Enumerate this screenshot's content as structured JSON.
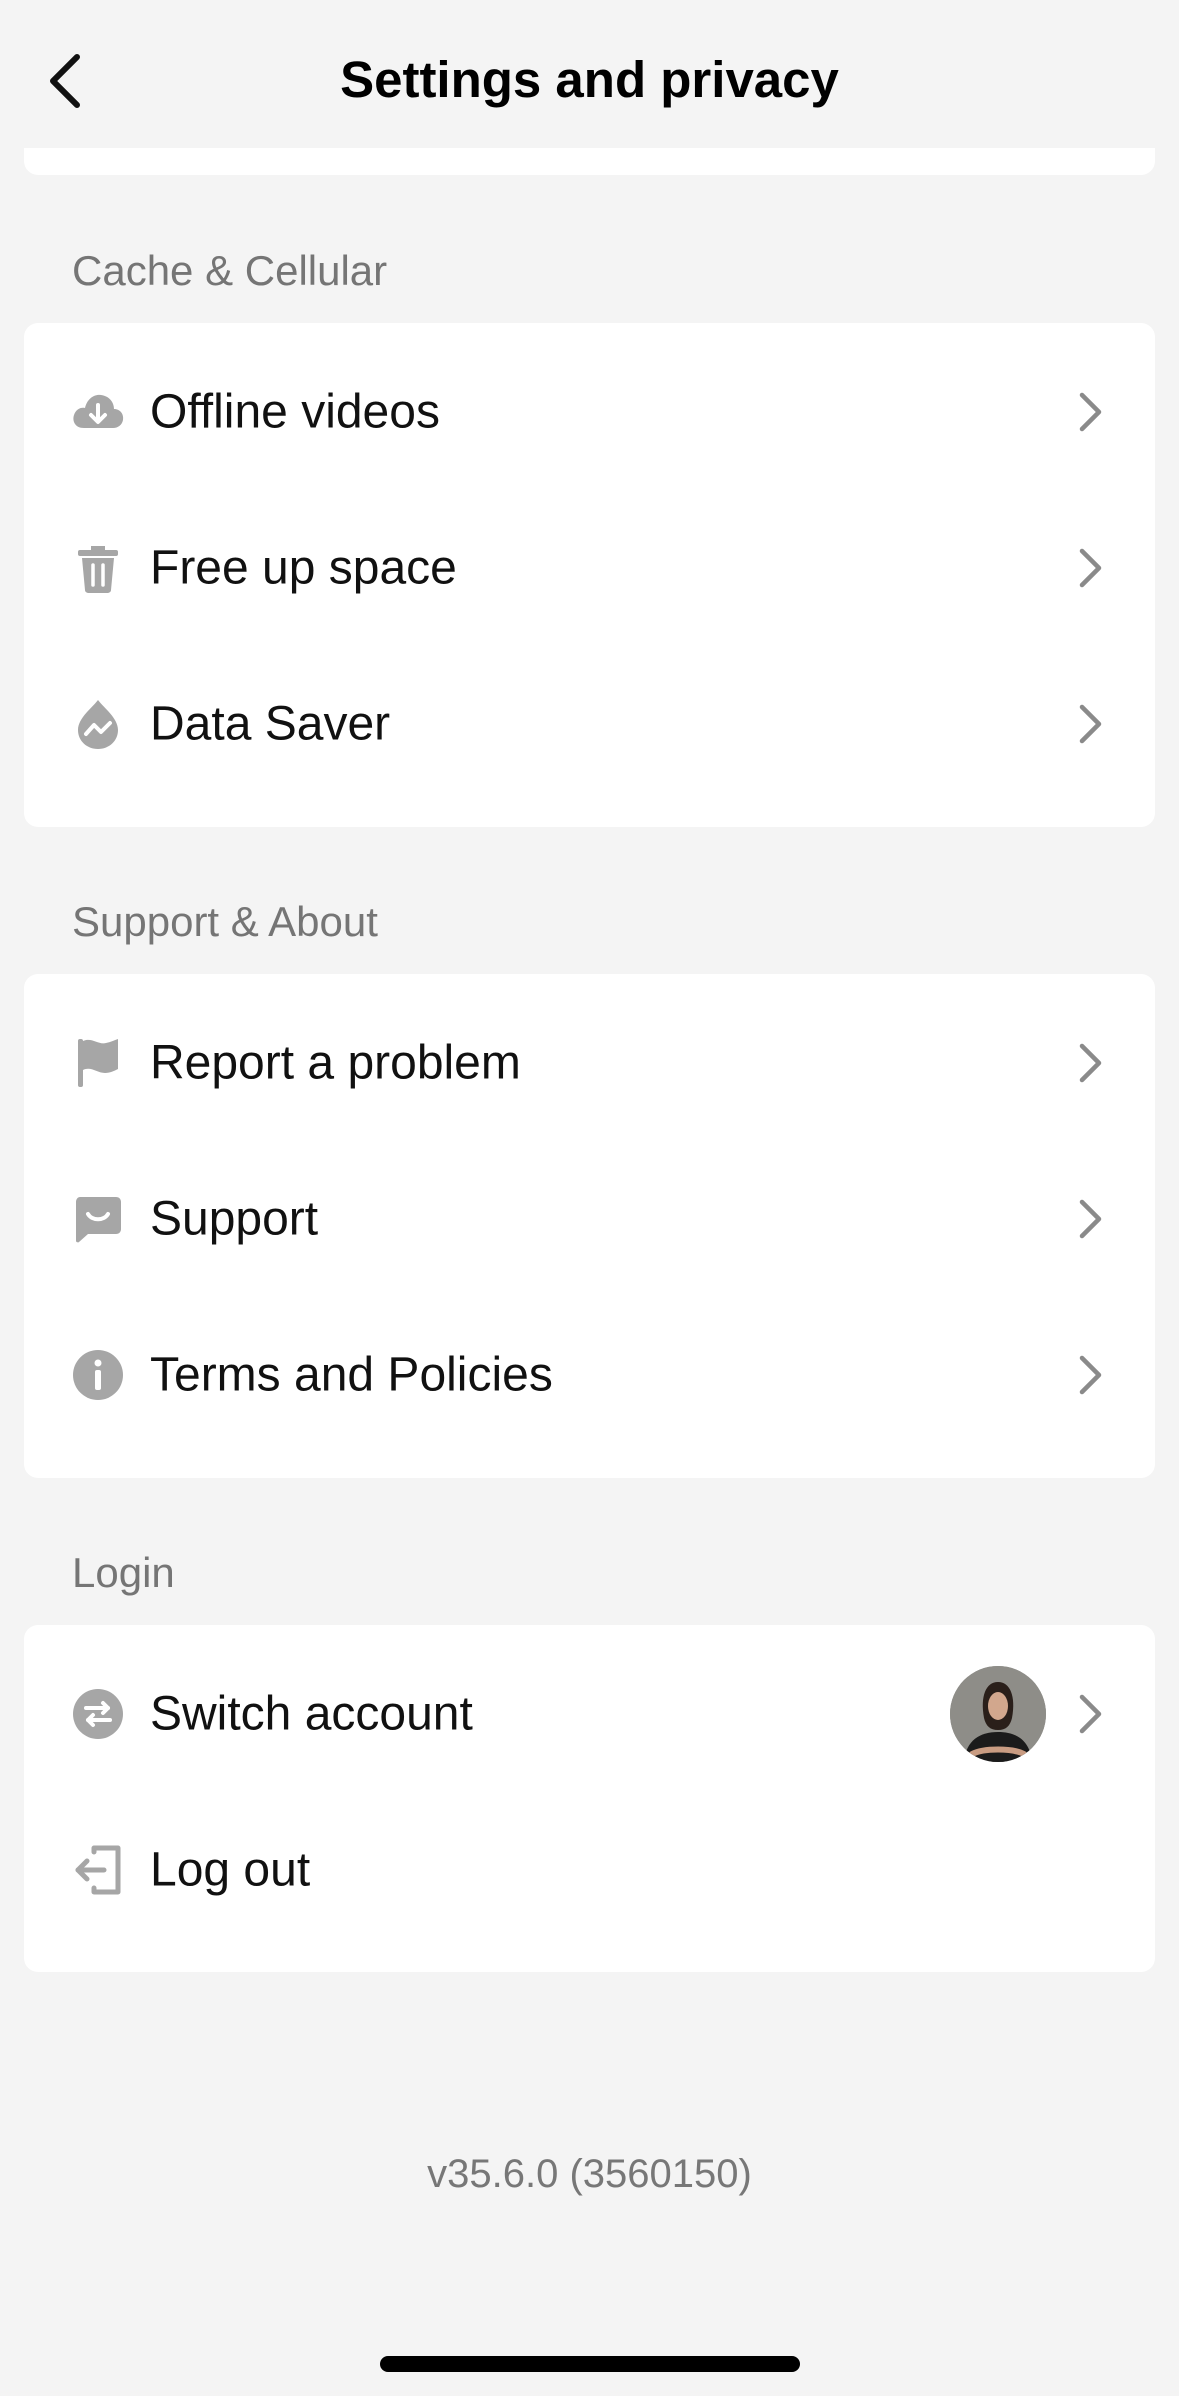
{
  "header": {
    "title": "Settings and privacy",
    "back_icon": "chevron-left-icon"
  },
  "sections": [
    {
      "label": "Cache & Cellular",
      "items": [
        {
          "label": "Offline videos",
          "icon": "cloud-download-icon"
        },
        {
          "label": "Free up space",
          "icon": "trash-icon"
        },
        {
          "label": "Data Saver",
          "icon": "data-saver-icon"
        }
      ]
    },
    {
      "label": "Support & About",
      "items": [
        {
          "label": "Report a problem",
          "icon": "flag-icon"
        },
        {
          "label": "Support",
          "icon": "chat-bubble-icon"
        },
        {
          "label": "Terms and Policies",
          "icon": "info-icon"
        }
      ]
    },
    {
      "label": "Login",
      "items": [
        {
          "label": "Switch account",
          "icon": "switch-arrows-icon"
        },
        {
          "label": "Log out",
          "icon": "logout-icon"
        }
      ]
    }
  ],
  "version": "v35.6.0 (3560150)",
  "colors": {
    "background": "#f4f4f4",
    "card": "#ffffff",
    "icon_gray": "#a6a6a6",
    "chevron": "#8a8a8a",
    "section_label": "#757575"
  }
}
